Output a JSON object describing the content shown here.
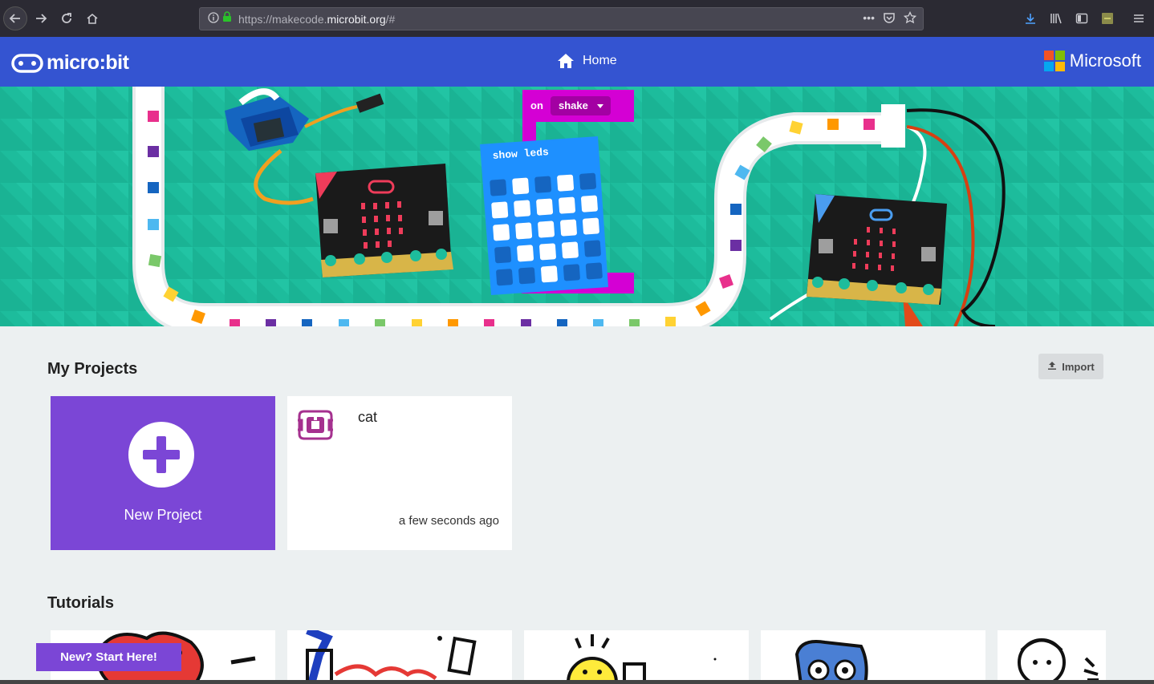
{
  "browser": {
    "url_prefix": "https://makecode.",
    "url_domain": "microbit.org",
    "url_suffix": "/#",
    "actions_dots": "•••"
  },
  "header": {
    "logo_text": "micro:bit",
    "home_label": "Home",
    "ms_text": "Microsoft"
  },
  "hero": {
    "on_label": "on",
    "shake_label": "shake",
    "show_leds_label": "show leds"
  },
  "projects": {
    "title": "My Projects",
    "import_label": "Import",
    "new_project_label": "New Project",
    "items": [
      {
        "name": "cat",
        "time": "a few seconds ago"
      }
    ]
  },
  "tutorials": {
    "title": "Tutorials",
    "start_label": "New? Start Here!"
  },
  "colors": {
    "header_blue": "#3454d1",
    "hero_green": "#1dbc9c",
    "purple": "#7b46d6",
    "project_icon": "#a5318f"
  },
  "icons": [
    "back-icon",
    "forward-icon",
    "reload-icon",
    "home-icon",
    "info-icon",
    "lock-icon",
    "pocket-icon",
    "star-icon",
    "download-icon",
    "library-icon",
    "sidebar-icon",
    "extension-icon",
    "menu-icon",
    "upload-icon",
    "plus-icon",
    "microbit-logo-icon",
    "microsoft-logo-icon"
  ]
}
